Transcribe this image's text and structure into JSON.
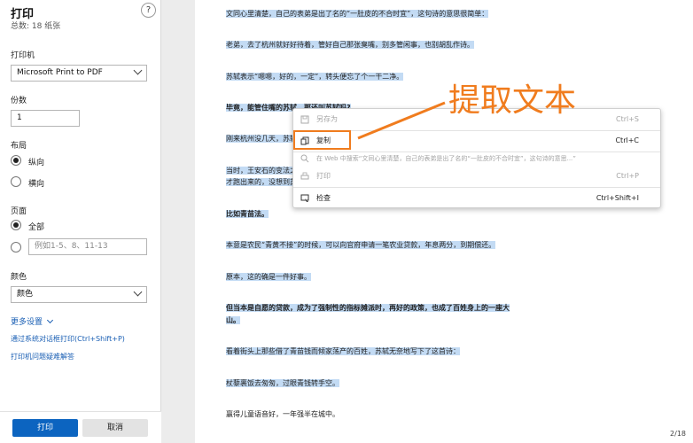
{
  "panel": {
    "title": "打印",
    "subtitle": "总数: 18 纸张",
    "help_glyph": "?",
    "printer_label": "打印机",
    "printer_value": "Microsoft Print to PDF",
    "copies_label": "份数",
    "copies_value": "1",
    "layout_label": "布局",
    "layout_portrait": "纵向",
    "layout_landscape": "横向",
    "pages_label": "页面",
    "pages_all": "全部",
    "pages_placeholder": "例如1-5、8、11-13",
    "color_label": "颜色",
    "color_value": "颜色",
    "more_settings": "更多设置",
    "system_print": "通过系统对话框打印(Ctrl+Shift+P)",
    "troubleshoot": "打印机问题疑难解答",
    "print_button": "打印",
    "cancel_button": "取消"
  },
  "document": {
    "lines": [
      "文同心里清楚，自己的表弟是出了名的“一肚皮的不合时宜”，这句诗的意思很简单：",
      "老弟，去了杭州就好好待着，管好自己那张臭嘴，别多管闲事，也别胡乱作诗。",
      "苏轼表示“嗯嗯，好的，一定”，转头便忘了个一干二净。",
      "毕竟，能管住嘴的苏轼，那还叫苏轼吗?",
      "刚来杭州没几天，苏轼",
      "当时，王安石的变法之",
      "才跑出来的，没想到苏",
      "比如青苗法。",
      "本意是农民“青黄不接”的时候，可以向官府申请一笔农业贷款，年息两分，到期偿还。",
      "原本，这的确是一件好事。",
      "但当本是自愿的贷款，成为了强制性的指标摊派时，再好的政策，也成了百姓身上的一座大",
      "山。",
      "看着街头上那些借了青苗钱而倾家荡产的百姓，苏轼无奈地写下了这首诗：",
      "杖藜裹饭去匆匆，过眼青钱转手空。",
      "赢得儿童语音好，一年强半在城中。"
    ],
    "page_number": "2/18"
  },
  "context_menu": {
    "save_as": "另存为",
    "save_as_shortcut": "Ctrl+S",
    "copy": "复制",
    "copy_shortcut": "Ctrl+C",
    "search_web": "在 Web 中搜索“文同心里清楚，自己的表弟是出了名的“一肚皮的不合时宜”，这句诗的意思...”",
    "print": "打印",
    "print_shortcut": "Ctrl+P",
    "inspect": "检查",
    "inspect_shortcut": "Ctrl+Shift+I"
  },
  "annotation": {
    "text": "提取文本",
    "color": "#f07c1e"
  }
}
